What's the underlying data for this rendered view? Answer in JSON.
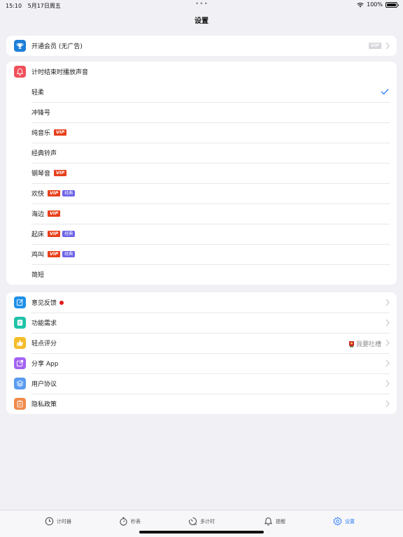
{
  "status_bar": {
    "time": "15:10",
    "date": "5月17日周五",
    "dots": "•••",
    "battery": "100%",
    "battery_level": 1.0
  },
  "nav": {
    "title": "设置"
  },
  "membership": {
    "label": "开通会员 (无广告)",
    "badge": "VIP",
    "icon": "trophy-icon",
    "icon_color": "#1e7fd8"
  },
  "sound": {
    "header": "计时结束时播放声音",
    "header_icon": "bell-icon",
    "header_icon_color": "#f0505a",
    "options": [
      {
        "label": "轻柔",
        "vip": "",
        "classic": "",
        "selected": true
      },
      {
        "label": "冲锋号",
        "vip": "",
        "classic": "",
        "selected": false
      },
      {
        "label": "纯音乐",
        "vip": "VIP",
        "classic": "",
        "selected": false
      },
      {
        "label": "经典铃声",
        "vip": "",
        "classic": "",
        "selected": false
      },
      {
        "label": "钢琴音",
        "vip": "VIP",
        "classic": "",
        "selected": false
      },
      {
        "label": "欢快",
        "vip": "VIP",
        "classic": "经典",
        "selected": false
      },
      {
        "label": "海边",
        "vip": "VIP",
        "classic": "",
        "selected": false
      },
      {
        "label": "起床",
        "vip": "VIP",
        "classic": "经典",
        "selected": false
      },
      {
        "label": "鸡叫",
        "vip": "VIP",
        "classic": "经典",
        "selected": false
      },
      {
        "label": "简短",
        "vip": "",
        "classic": "",
        "selected": false
      }
    ]
  },
  "misc": {
    "items": [
      {
        "label": "意见反馈",
        "icon": "edit-icon",
        "color": "#1e90e8",
        "dot": true
      },
      {
        "label": "功能需求",
        "icon": "note-icon",
        "color": "#1fc3a8"
      },
      {
        "label": "轻点评分",
        "icon": "thumbs-up-icon",
        "color": "#f5bd2a",
        "extra": "我要吐槽"
      },
      {
        "label": "分享 App",
        "icon": "share-icon",
        "color": "#a463f2"
      },
      {
        "label": "用户协议",
        "icon": "layers-icon",
        "color": "#5a9cf0"
      },
      {
        "label": "隐私政策",
        "icon": "clipboard-icon",
        "color": "#f08a4b"
      }
    ]
  },
  "tabs": [
    {
      "label": "计时器",
      "icon": "clock-icon",
      "active": false
    },
    {
      "label": "秒表",
      "icon": "stopwatch-icon",
      "active": false
    },
    {
      "label": "多计时",
      "icon": "multi-timer-icon",
      "active": false
    },
    {
      "label": "提醒",
      "icon": "bell-icon",
      "active": false
    },
    {
      "label": "设置",
      "icon": "gear-icon",
      "active": true
    }
  ],
  "colors": {
    "accent": "#2d7cf6",
    "vip_badge": "#e8401c",
    "classic_badge": "#6c63e8",
    "background": "#f0f0f5"
  }
}
